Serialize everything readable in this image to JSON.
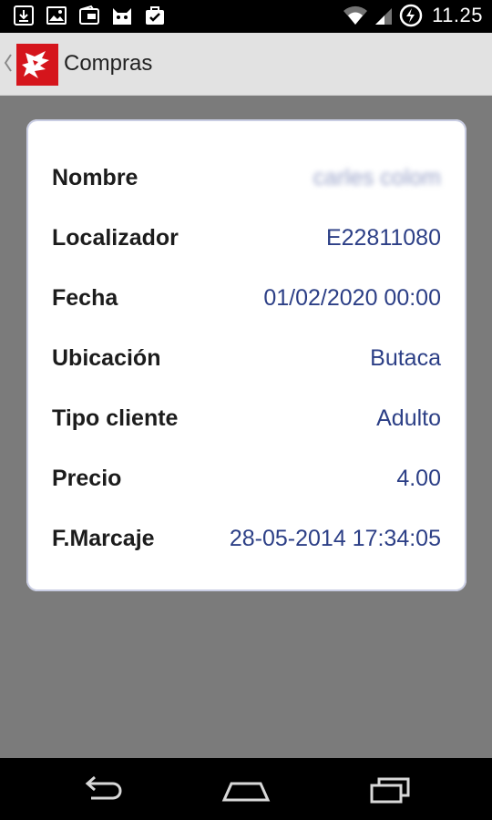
{
  "status_bar": {
    "time": "11.25",
    "icons": [
      "download-icon",
      "image-icon",
      "wallet-icon",
      "cat-icon",
      "bag-check-icon",
      "wifi-icon",
      "signal-icon",
      "battery-charging-icon"
    ]
  },
  "action_bar": {
    "title": "Compras",
    "logo_color": "#d5151c"
  },
  "details": [
    {
      "label": "Nombre",
      "value": "carles colom"
    },
    {
      "label": "Localizador",
      "value": "E22811080"
    },
    {
      "label": "Fecha",
      "value": "01/02/2020 00:00"
    },
    {
      "label": "Ubicación",
      "value": "Butaca"
    },
    {
      "label": "Tipo cliente",
      "value": "Adulto"
    },
    {
      "label": "Precio",
      "value": "4.00"
    },
    {
      "label": "F.Marcaje",
      "value": "28-05-2014 17:34:05"
    }
  ],
  "colors": {
    "value_text": "#2c3f86",
    "label_text": "#1c1c1c",
    "background": "#7b7b7b",
    "action_bar": "#e2e2e2"
  },
  "nav_bar": {
    "icons": [
      "back-icon",
      "home-icon",
      "recents-icon"
    ]
  }
}
